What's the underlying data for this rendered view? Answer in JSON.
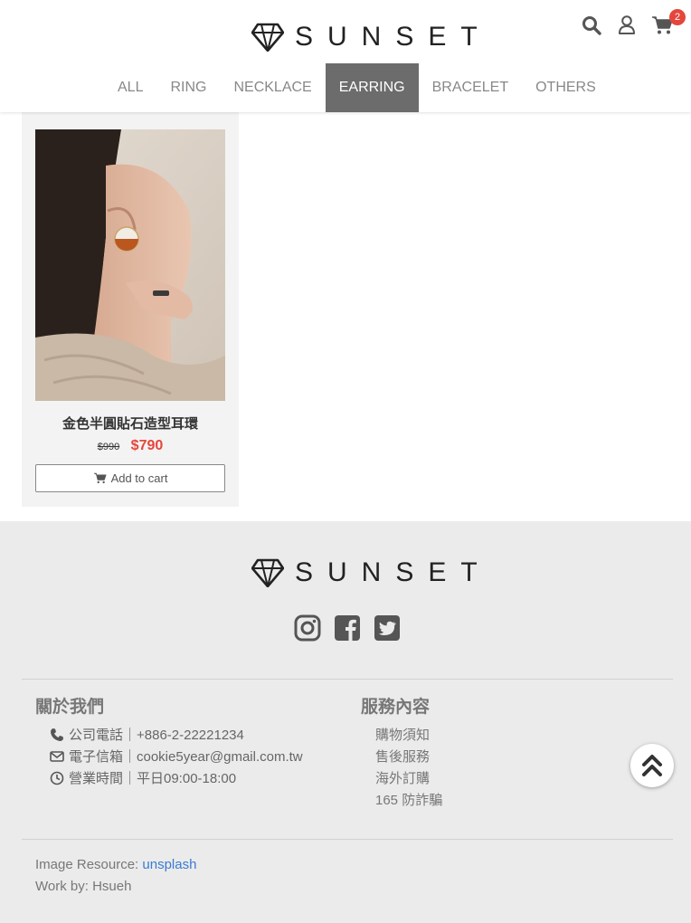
{
  "brand": {
    "name": "SUNSET"
  },
  "header": {
    "cart_count": "2",
    "nav": [
      {
        "label": "ALL"
      },
      {
        "label": "RING"
      },
      {
        "label": "NECKLACE"
      },
      {
        "label": "EARRING",
        "active": true
      },
      {
        "label": "BRACELET"
      },
      {
        "label": "OTHERS"
      }
    ]
  },
  "product": {
    "name": "金色半圓貼石造型耳環",
    "old_price": "$990",
    "price": "$790",
    "add_to_cart": "Add to cart"
  },
  "footer": {
    "about": {
      "title": "關於我們",
      "phone": "公司電話｜+886-2-22221234",
      "email": "電子信箱｜cookie5year@gmail.com.tw",
      "hours": "營業時間｜平日09:00-18:00"
    },
    "service": {
      "title": "服務內容",
      "links": [
        "購物須知",
        "售後服務",
        "海外訂購",
        "165 防詐騙"
      ]
    },
    "credit": {
      "image_label": "Image Resource: ",
      "image_link": "unsplash",
      "work_by": "Work by: Hsueh"
    }
  },
  "colors": {
    "accent": "#e5463b",
    "nav_active": "#6c6c6c",
    "link": "#3a7bd5"
  }
}
